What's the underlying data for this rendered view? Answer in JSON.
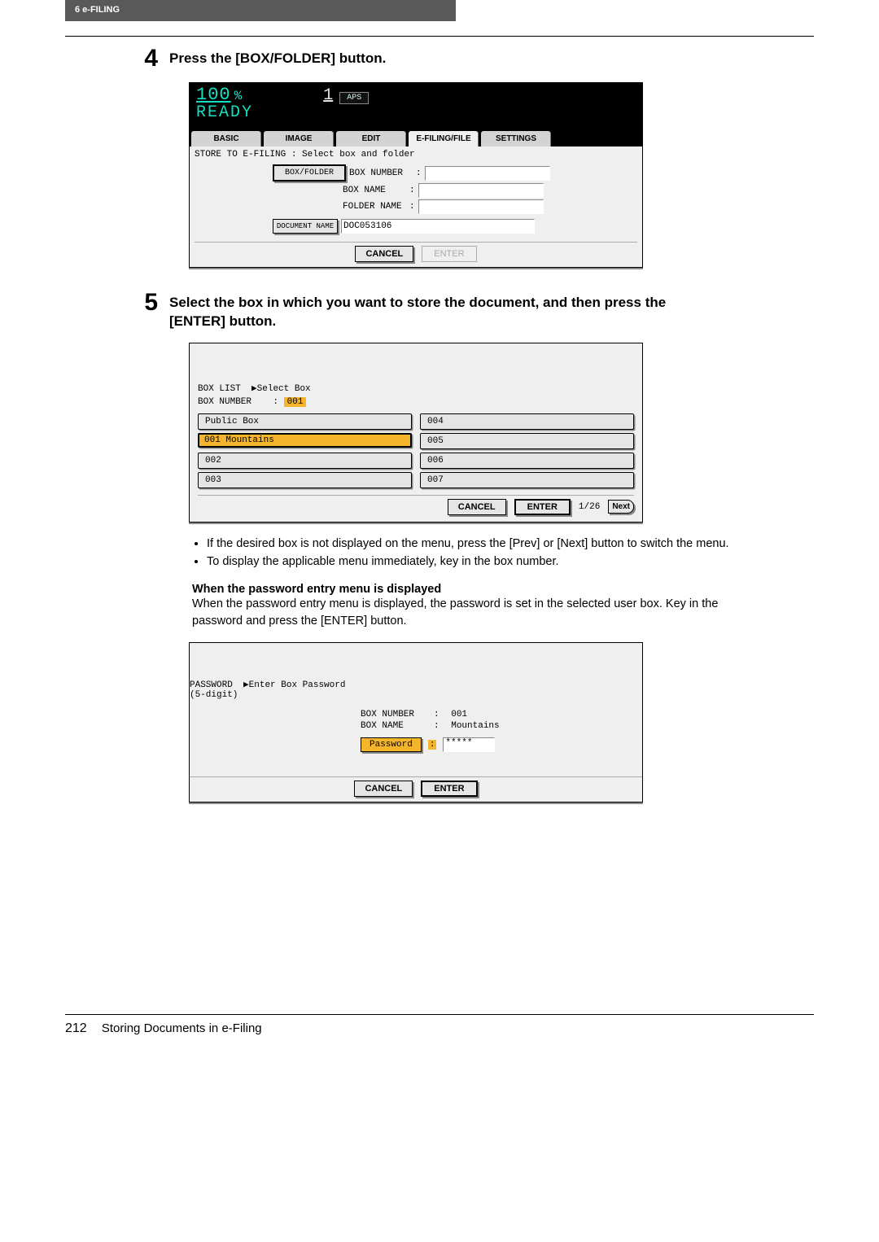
{
  "header": {
    "chapter": "6   e-FILING"
  },
  "step4": {
    "number": "4",
    "title": "Press the [BOX/FOLDER] button."
  },
  "panel1": {
    "percent": "100",
    "pct_sym": "%",
    "count": "1",
    "aps": "APS",
    "ready": "READY",
    "tabs": {
      "basic": "BASIC",
      "image": "IMAGE",
      "edit": "EDIT",
      "efiling": "E-FILING/FILE",
      "settings": "SETTINGS"
    },
    "instr": "STORE TO E-FILING : Select box and folder",
    "btn_boxfolder": "BOX/FOLDER",
    "lbl_boxnumber": "BOX NUMBER",
    "lbl_boxname": "BOX NAME",
    "lbl_foldername": "FOLDER NAME",
    "btn_docname": "DOCUMENT NAME",
    "val_docname": "DOC053106",
    "cancel": "CANCEL",
    "enter": "ENTER"
  },
  "step5": {
    "number": "5",
    "title": "Select the box in which you want to store the document, and then press the [ENTER] button."
  },
  "panel2": {
    "boxlist_lbl": "BOX LIST",
    "boxlist_instr": "▶Select Box",
    "boxnum_lbl": "BOX NUMBER",
    "boxnum_colon": ":",
    "boxnum_val": "001",
    "items": {
      "public": "Public Box",
      "b001": "001 Mountains",
      "b002": "002",
      "b003": "003",
      "b004": "004",
      "b005": "005",
      "b006": "006",
      "b007": "007"
    },
    "cancel": "CANCEL",
    "enter": "ENTER",
    "page": "1/26",
    "next": "Next"
  },
  "notes": {
    "n1": "If the desired box is not displayed on the menu, press the [Prev] or [Next] button to switch the menu.",
    "n2": "To display the applicable menu immediately, key in the box number."
  },
  "pw_section": {
    "heading": "When the password entry menu is displayed",
    "para": "When the password entry menu is displayed, the password is set in the selected user box. Key in the password and press the [ENTER] button."
  },
  "panel3": {
    "pw_lbl": "PASSWORD",
    "pw_instr": "▶Enter Box Password",
    "digits": "(5-digit)",
    "boxnum_lbl": "BOX NUMBER",
    "boxnum_val": "001",
    "boxname_lbl": "BOX NAME",
    "boxname_val": "Mountains",
    "pw_btn": "Password",
    "pw_val": "*****",
    "cancel": "CANCEL",
    "enter": "ENTER"
  },
  "footer": {
    "page": "212",
    "title": "Storing Documents in e-Filing"
  }
}
